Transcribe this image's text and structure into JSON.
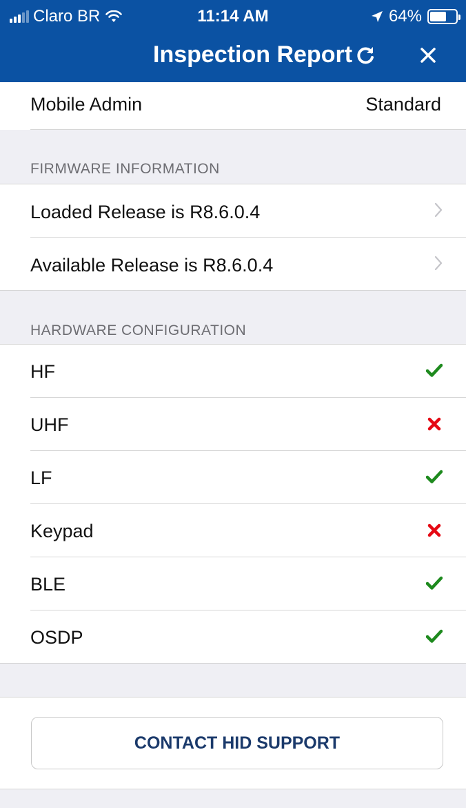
{
  "status_bar": {
    "carrier": "Claro BR",
    "time": "11:14 AM",
    "battery": "64%",
    "battery_level": 0.64,
    "signal_bars": 3,
    "icons": [
      "signal-icon",
      "wifi-icon",
      "location-arrow-icon",
      "battery-icon"
    ]
  },
  "nav": {
    "title": "Inspection Report",
    "refresh_icon": "refresh-icon",
    "close_icon": "close-icon"
  },
  "admin_row": {
    "label": "Mobile Admin",
    "value": "Standard"
  },
  "firmware": {
    "header": "FIRMWARE INFORMATION",
    "items": [
      {
        "label": "Loaded Release is R8.6.0.4"
      },
      {
        "label": "Available Release is R8.6.0.4"
      }
    ]
  },
  "hardware": {
    "header": "HARDWARE CONFIGURATION",
    "items": [
      {
        "label": "HF",
        "status": "check"
      },
      {
        "label": "UHF",
        "status": "cross"
      },
      {
        "label": "LF",
        "status": "check"
      },
      {
        "label": "Keypad",
        "status": "cross"
      },
      {
        "label": "BLE",
        "status": "check"
      },
      {
        "label": "OSDP",
        "status": "check"
      }
    ]
  },
  "contact_button": {
    "label": "CONTACT HID SUPPORT"
  },
  "colors": {
    "header_bg": "#0B52A3",
    "check": "#1E8A1E",
    "cross": "#E50914",
    "group_bg": "#EFEFF4"
  }
}
